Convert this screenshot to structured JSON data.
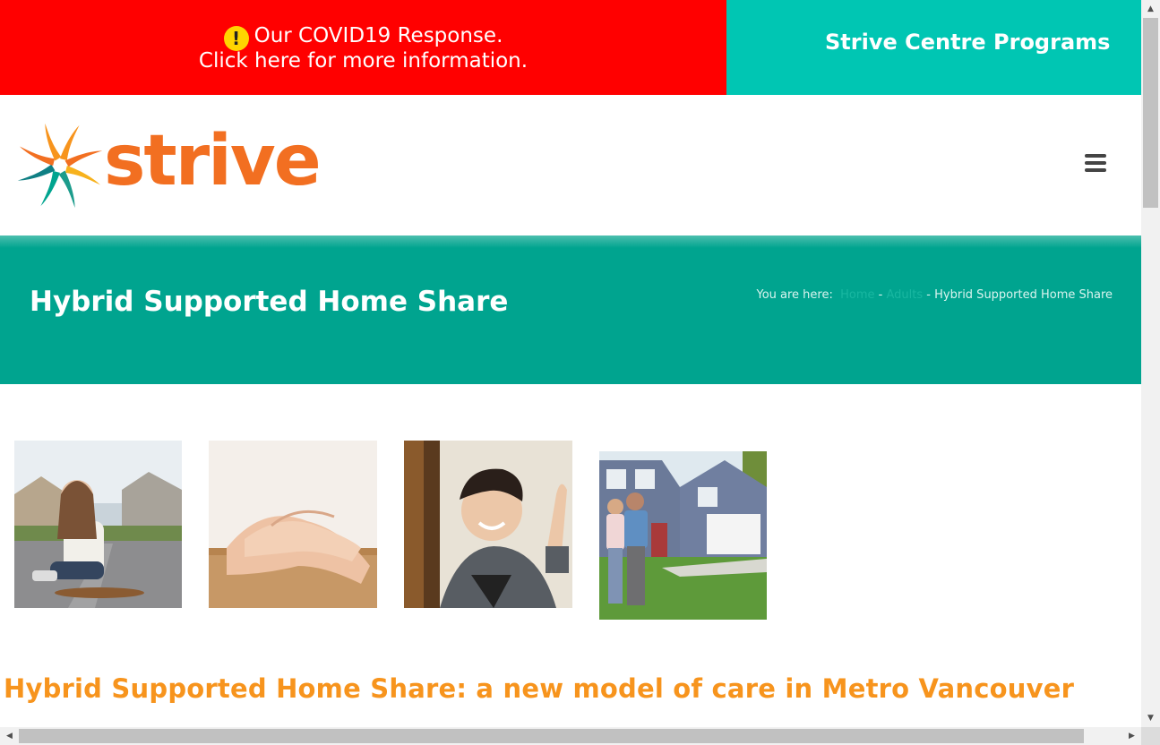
{
  "topbar": {
    "covid_line1": "Our COVID19 Response.",
    "covid_line2": "Click here for more information.",
    "warning_glyph": "!",
    "programs_label": "Strive Centre Programs",
    "covid_color": "#ff0000",
    "programs_color": "#00c6b3"
  },
  "header": {
    "logo_text": "strive",
    "menu_icon": "hamburger-menu-icon",
    "logo_color": "#f26f21"
  },
  "title_band": {
    "title": "Hybrid Supported Home Share",
    "breadcrumb_prefix": "You are here:",
    "breadcrumb_items": [
      "Home",
      "Adults"
    ],
    "breadcrumb_separator": "-",
    "breadcrumb_current": "Hybrid Supported Home Share",
    "band_color": "#00a48f"
  },
  "gallery": {
    "images": [
      {
        "subject": "woman sitting on a street with a skateboard"
      },
      {
        "subject": "hands holding hands"
      },
      {
        "subject": "smiling young man waving"
      },
      {
        "subject": "couple in front of a house"
      }
    ]
  },
  "main": {
    "heading": "Hybrid Supported Home Share: a new model of care in Metro Vancouver",
    "heading_color": "#f7941d"
  },
  "scrollbars": {
    "up_arrow": "▲",
    "down_arrow": "▼",
    "left_arrow": "◀",
    "right_arrow": "▶"
  }
}
